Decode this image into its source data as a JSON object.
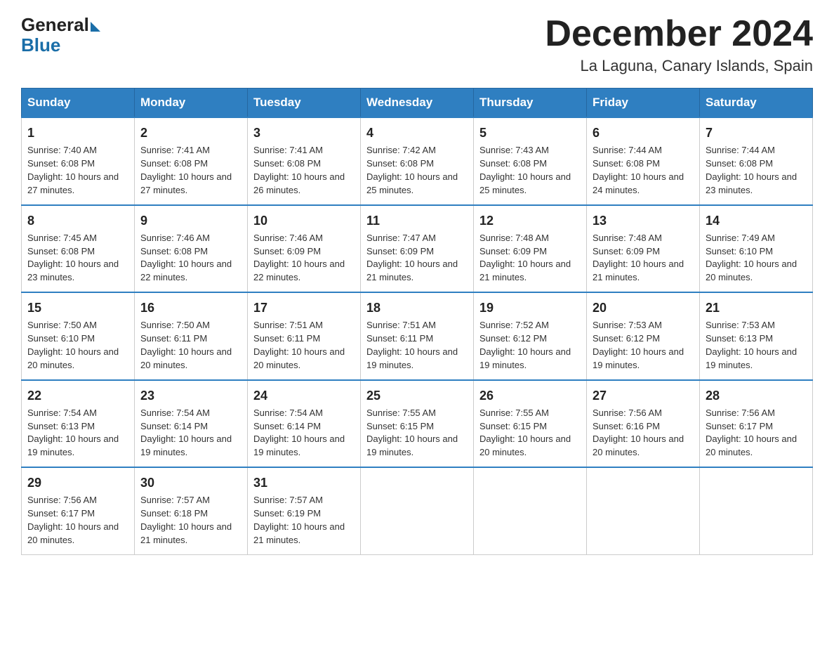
{
  "header": {
    "logo": {
      "general": "General",
      "blue": "Blue"
    },
    "month_title": "December 2024",
    "location": "La Laguna, Canary Islands, Spain"
  },
  "weekdays": [
    "Sunday",
    "Monday",
    "Tuesday",
    "Wednesday",
    "Thursday",
    "Friday",
    "Saturday"
  ],
  "weeks": [
    [
      {
        "day": "1",
        "sunrise": "7:40 AM",
        "sunset": "6:08 PM",
        "daylight": "10 hours and 27 minutes."
      },
      {
        "day": "2",
        "sunrise": "7:41 AM",
        "sunset": "6:08 PM",
        "daylight": "10 hours and 27 minutes."
      },
      {
        "day": "3",
        "sunrise": "7:41 AM",
        "sunset": "6:08 PM",
        "daylight": "10 hours and 26 minutes."
      },
      {
        "day": "4",
        "sunrise": "7:42 AM",
        "sunset": "6:08 PM",
        "daylight": "10 hours and 25 minutes."
      },
      {
        "day": "5",
        "sunrise": "7:43 AM",
        "sunset": "6:08 PM",
        "daylight": "10 hours and 25 minutes."
      },
      {
        "day": "6",
        "sunrise": "7:44 AM",
        "sunset": "6:08 PM",
        "daylight": "10 hours and 24 minutes."
      },
      {
        "day": "7",
        "sunrise": "7:44 AM",
        "sunset": "6:08 PM",
        "daylight": "10 hours and 23 minutes."
      }
    ],
    [
      {
        "day": "8",
        "sunrise": "7:45 AM",
        "sunset": "6:08 PM",
        "daylight": "10 hours and 23 minutes."
      },
      {
        "day": "9",
        "sunrise": "7:46 AM",
        "sunset": "6:08 PM",
        "daylight": "10 hours and 22 minutes."
      },
      {
        "day": "10",
        "sunrise": "7:46 AM",
        "sunset": "6:09 PM",
        "daylight": "10 hours and 22 minutes."
      },
      {
        "day": "11",
        "sunrise": "7:47 AM",
        "sunset": "6:09 PM",
        "daylight": "10 hours and 21 minutes."
      },
      {
        "day": "12",
        "sunrise": "7:48 AM",
        "sunset": "6:09 PM",
        "daylight": "10 hours and 21 minutes."
      },
      {
        "day": "13",
        "sunrise": "7:48 AM",
        "sunset": "6:09 PM",
        "daylight": "10 hours and 21 minutes."
      },
      {
        "day": "14",
        "sunrise": "7:49 AM",
        "sunset": "6:10 PM",
        "daylight": "10 hours and 20 minutes."
      }
    ],
    [
      {
        "day": "15",
        "sunrise": "7:50 AM",
        "sunset": "6:10 PM",
        "daylight": "10 hours and 20 minutes."
      },
      {
        "day": "16",
        "sunrise": "7:50 AM",
        "sunset": "6:11 PM",
        "daylight": "10 hours and 20 minutes."
      },
      {
        "day": "17",
        "sunrise": "7:51 AM",
        "sunset": "6:11 PM",
        "daylight": "10 hours and 20 minutes."
      },
      {
        "day": "18",
        "sunrise": "7:51 AM",
        "sunset": "6:11 PM",
        "daylight": "10 hours and 19 minutes."
      },
      {
        "day": "19",
        "sunrise": "7:52 AM",
        "sunset": "6:12 PM",
        "daylight": "10 hours and 19 minutes."
      },
      {
        "day": "20",
        "sunrise": "7:53 AM",
        "sunset": "6:12 PM",
        "daylight": "10 hours and 19 minutes."
      },
      {
        "day": "21",
        "sunrise": "7:53 AM",
        "sunset": "6:13 PM",
        "daylight": "10 hours and 19 minutes."
      }
    ],
    [
      {
        "day": "22",
        "sunrise": "7:54 AM",
        "sunset": "6:13 PM",
        "daylight": "10 hours and 19 minutes."
      },
      {
        "day": "23",
        "sunrise": "7:54 AM",
        "sunset": "6:14 PM",
        "daylight": "10 hours and 19 minutes."
      },
      {
        "day": "24",
        "sunrise": "7:54 AM",
        "sunset": "6:14 PM",
        "daylight": "10 hours and 19 minutes."
      },
      {
        "day": "25",
        "sunrise": "7:55 AM",
        "sunset": "6:15 PM",
        "daylight": "10 hours and 19 minutes."
      },
      {
        "day": "26",
        "sunrise": "7:55 AM",
        "sunset": "6:15 PM",
        "daylight": "10 hours and 20 minutes."
      },
      {
        "day": "27",
        "sunrise": "7:56 AM",
        "sunset": "6:16 PM",
        "daylight": "10 hours and 20 minutes."
      },
      {
        "day": "28",
        "sunrise": "7:56 AM",
        "sunset": "6:17 PM",
        "daylight": "10 hours and 20 minutes."
      }
    ],
    [
      {
        "day": "29",
        "sunrise": "7:56 AM",
        "sunset": "6:17 PM",
        "daylight": "10 hours and 20 minutes."
      },
      {
        "day": "30",
        "sunrise": "7:57 AM",
        "sunset": "6:18 PM",
        "daylight": "10 hours and 21 minutes."
      },
      {
        "day": "31",
        "sunrise": "7:57 AM",
        "sunset": "6:19 PM",
        "daylight": "10 hours and 21 minutes."
      },
      null,
      null,
      null,
      null
    ]
  ]
}
